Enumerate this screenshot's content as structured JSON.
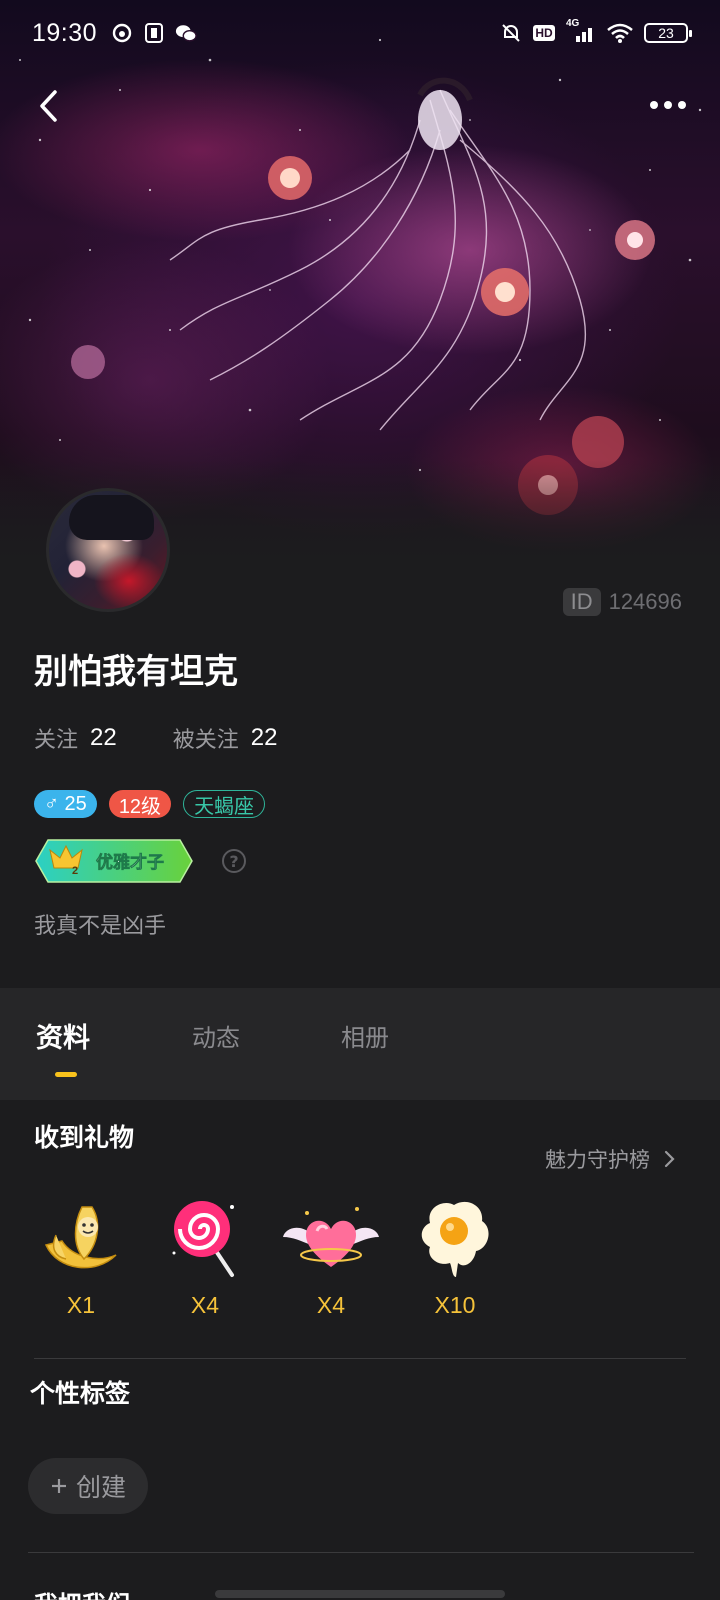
{
  "status_bar": {
    "time": "19:30",
    "network": "4G",
    "hd_label": "HD",
    "battery": "23"
  },
  "profile": {
    "nickname": "别怕我有坦克",
    "id_label": "ID",
    "id_value": "124696",
    "follow_label": "关注",
    "follow_count": "22",
    "followers_label": "被关注",
    "followers_count": "22",
    "gender_age": "♂ 25",
    "level": "12级",
    "zodiac": "天蝎座",
    "medal_text": "优雅才子",
    "medal_level": "2",
    "bio": "我真不是凶手"
  },
  "tabs": [
    {
      "label": "资料",
      "active": true
    },
    {
      "label": "动态",
      "active": false
    },
    {
      "label": "相册",
      "active": false
    }
  ],
  "gifts_section": {
    "title": "收到礼物",
    "guard_link": "魅力守护榜",
    "items": [
      {
        "icon": "banana-gift-icon",
        "count": "X1"
      },
      {
        "icon": "lollipop-gift-icon",
        "count": "X4"
      },
      {
        "icon": "winged-heart-gift-icon",
        "count": "X4"
      },
      {
        "icon": "fried-egg-gift-icon",
        "count": "X10"
      }
    ]
  },
  "tags_section": {
    "title": "个性标签",
    "create_label": "创建"
  },
  "bottom_section": {
    "title": "我把我们"
  },
  "colors": {
    "accent_yellow": "#f8c21c",
    "gift_count": "#f5c23a",
    "gender_tag": "#3bb4ec",
    "level_tag": "#ef5646",
    "zodiac_tag": "#38c7a8",
    "background": "#1c1c1e"
  }
}
